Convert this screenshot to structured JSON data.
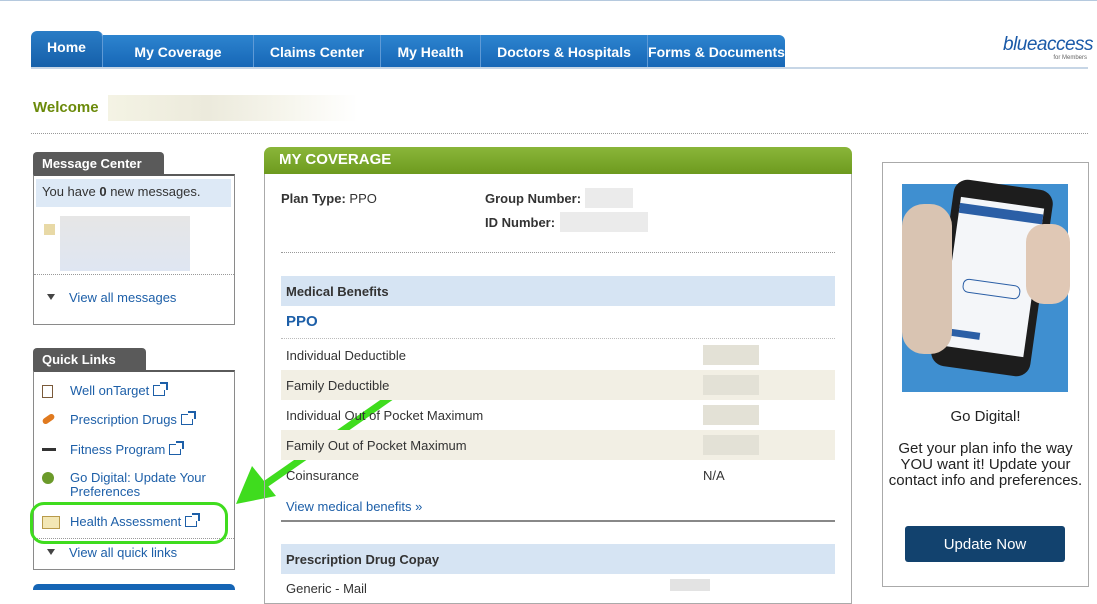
{
  "nav": {
    "tabs": [
      "Home",
      "My Coverage",
      "Claims Center",
      "My Health",
      "Doctors & Hospitals",
      "Forms & Documents"
    ],
    "logo_text": "blueaccess",
    "logo_sub": "for Members"
  },
  "welcome": "Welcome",
  "message_center": {
    "title": "Message Center",
    "text_before": "You have ",
    "count": "0",
    "text_after": " new messages.",
    "view_all": "View all messages"
  },
  "quick_links": {
    "title": "Quick Links",
    "items": [
      {
        "label": "Well onTarget",
        "icon": "clipboard-icon"
      },
      {
        "label": "Prescription Drugs",
        "icon": "pill-icon"
      },
      {
        "label": "Fitness Program",
        "icon": "dumbbell-icon"
      },
      {
        "label": "Go Digital: Update Your Preferences",
        "icon": "tree-icon"
      },
      {
        "label": "Health Assessment",
        "icon": "folder-icon"
      }
    ],
    "view_all": "View all quick links"
  },
  "coverage": {
    "title": "MY COVERAGE",
    "plan_type_label": "Plan Type:",
    "plan_type_value": "PPO",
    "group_number_label": "Group Number:",
    "id_number_label": "ID Number:",
    "medical_title": "Medical Benefits",
    "medical_plan": "PPO",
    "rows": [
      {
        "label": "Individual Deductible",
        "value": ""
      },
      {
        "label": "Family Deductible",
        "value": ""
      },
      {
        "label": "Individual Out of Pocket Maximum",
        "value": ""
      },
      {
        "label": "Family Out of Pocket Maximum",
        "value": ""
      },
      {
        "label": "Coinsurance",
        "value": "N/A"
      }
    ],
    "view_medical": "View medical benefits »",
    "rx_title": "Prescription Drug Copay",
    "rx_row": "Generic - Mail"
  },
  "promo": {
    "title": "Go Digital!",
    "text": "Get your plan info the way YOU want it! Update your contact info and preferences.",
    "button": "Update Now"
  },
  "colors": {
    "tab_blue": "#1565b5",
    "coverage_green": "#7aa82c",
    "highlight_green": "#3fdc1e",
    "button_navy": "#12426e"
  }
}
